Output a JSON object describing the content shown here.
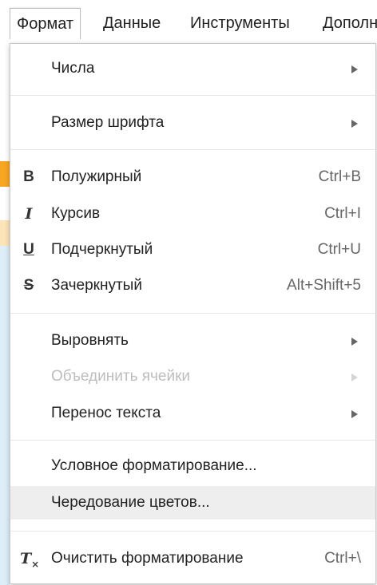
{
  "menubar": {
    "items": [
      "Формат",
      "Данные",
      "Инструменты",
      "Дополн"
    ]
  },
  "menu": {
    "items": {
      "numbers": {
        "label": "Числа"
      },
      "font_size": {
        "label": "Размер шрифта"
      },
      "bold": {
        "label": "Полужирный",
        "shortcut": "Ctrl+B",
        "icon_glyph": "B"
      },
      "italic": {
        "label": "Курсив",
        "shortcut": "Ctrl+I",
        "icon_glyph": "I"
      },
      "underline": {
        "label": "Подчеркнутый",
        "shortcut": "Ctrl+U",
        "icon_glyph": "U"
      },
      "strikethrough": {
        "label": "Зачеркнутый",
        "shortcut": "Alt+Shift+5",
        "icon_glyph": "S"
      },
      "align": {
        "label": "Выровнять"
      },
      "merge": {
        "label": "Объединить ячейки"
      },
      "wrap": {
        "label": "Перенос текста"
      },
      "conditional": {
        "label": "Условное форматирование..."
      },
      "alternating": {
        "label": "Чередование цветов..."
      },
      "clear": {
        "label": "Очистить форматирование",
        "shortcut": "Ctrl+\\",
        "icon_glyph": "T"
      }
    },
    "icons": {
      "bold": "bold-icon",
      "italic": "italic-icon",
      "underline": "underline-icon",
      "strikethrough": "strikethrough-icon",
      "clear": "clear-formatting-icon",
      "submenu": "submenu-arrow-icon"
    }
  },
  "colors": {
    "highlight": "#eeeeee",
    "disabled_text": "#bdbdbd",
    "sheet_orange": "#f6a623",
    "sheet_light_orange": "#fde3b8",
    "sheet_light_blue": "#ddeef9"
  }
}
